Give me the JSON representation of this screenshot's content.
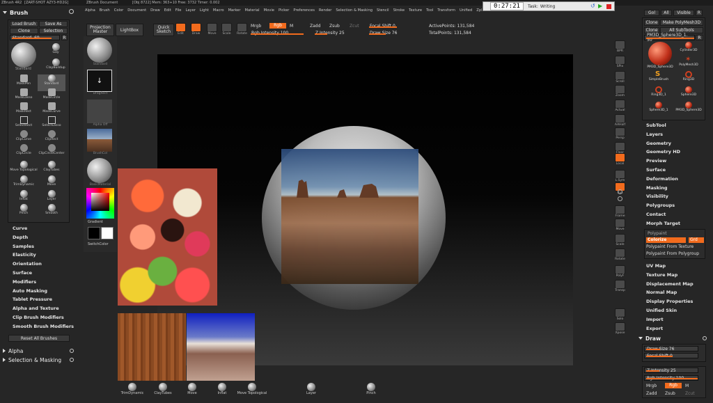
{
  "title_bar": {
    "app_label": "ZBrush 4R2",
    "info_text": "[ZART-SHOT AZY3-HD2G]",
    "document": "ZBrush Document",
    "stats": "[Obj 8722] Mem: 363+10 Free: 3732 Timer: 0.002"
  },
  "menu": [
    "Alpha",
    "Brush",
    "Color",
    "Document",
    "Draw",
    "Edit",
    "File",
    "Layer",
    "Light",
    "Macro",
    "Marker",
    "Material",
    "Movie",
    "Picker",
    "Preferences",
    "Render",
    "Selection & Masking",
    "Stencil",
    "Stroke",
    "Texture",
    "Tool",
    "Transform",
    "Unified",
    "Zplugin",
    "Zscript"
  ],
  "timer": {
    "time": "0:27:21",
    "task_label": "Task:",
    "task_value": "Writing"
  },
  "right_header_buttons": [
    "Gol",
    "All",
    "Visible",
    "R"
  ],
  "brush_palette": {
    "title": "Brush",
    "load": "Load Brush",
    "save": "Save As",
    "clone": "Clone",
    "selection": "SelectIon",
    "slider_label": "Standard. 69",
    "slider_value_fraction": 0.8,
    "r_btn": "R",
    "brushes": [
      {
        "label": "Standard",
        "icon": "sphere-icon"
      },
      {
        "label": "Gay",
        "icon": "sphere-icon"
      },
      {
        "label": "ClayBuildup",
        "icon": "sphere-icon"
      },
      {
        "label": "MaskPen",
        "icon": "mask-icon"
      },
      {
        "label": "Standard",
        "icon": "sphere-icon"
      },
      {
        "label": "MaskLasso",
        "icon": "mask-icon"
      },
      {
        "label": "MaskCircle",
        "icon": "mask-icon"
      },
      {
        "label": "MaskRect",
        "icon": "mask-icon"
      },
      {
        "label": "MaskCurve",
        "icon": "mask-icon"
      },
      {
        "label": "SelectRect",
        "icon": "select-icon"
      },
      {
        "label": "SelectLasso",
        "icon": "select-icon"
      },
      {
        "label": "ClipCurve",
        "icon": "clip-icon"
      },
      {
        "label": "ClipRect",
        "icon": "clip-icon"
      },
      {
        "label": "ClipCircle",
        "icon": "clip-icon"
      },
      {
        "label": "ClipCircleCenter",
        "icon": "clip-icon"
      },
      {
        "label": "Move Topological",
        "icon": "sphere-icon"
      },
      {
        "label": "ClayTubes",
        "icon": "sphere-icon"
      },
      {
        "label": "TrimDynamic",
        "icon": "sphere-icon"
      },
      {
        "label": "Move",
        "icon": "sphere-icon"
      },
      {
        "label": "Inflat",
        "icon": "sphere-icon"
      },
      {
        "label": "Layer",
        "icon": "sphere-icon"
      },
      {
        "label": "Pinch",
        "icon": "sphere-icon"
      },
      {
        "label": "Smooth",
        "icon": "sphere-icon"
      }
    ],
    "sections": [
      "Curve",
      "Depth",
      "Samples",
      "Elasticity",
      "Orientation",
      "Surface",
      "Modifiers",
      "Auto Masking",
      "Tablet Pressure",
      "Alpha and Texture",
      "Clip Brush Modifiers",
      "Smooth Brush Modifiers"
    ],
    "reset": "Reset All Brushes"
  },
  "left_bottom": {
    "alpha": "Alpha",
    "selection_masking": "Selection & Masking"
  },
  "tray": {
    "items": [
      {
        "label": "Standard"
      },
      {
        "label": "DragRect"
      },
      {
        "label": "Alpha Off"
      },
      {
        "label": "BrushCol"
      },
      {
        "label": "BasicMaterial"
      },
      {
        "label": "Gradient"
      },
      {
        "label": "SwitchColor"
      }
    ]
  },
  "top_toolbar": {
    "projection_master": "Projection Master",
    "lightbox": "LightBox",
    "quick_sketch": "Quick Sketch",
    "tools": [
      {
        "label": "Edit",
        "icon": "edit-icon",
        "active": true
      },
      {
        "label": "Draw",
        "icon": "draw-icon",
        "active": true
      },
      {
        "label": "Move",
        "icon": "move-icon",
        "active": false
      },
      {
        "label": "Scale",
        "icon": "scale-icon",
        "active": false
      },
      {
        "label": "Rotate",
        "icon": "rotate-icon",
        "active": false
      }
    ],
    "mrgb": "Mrgb",
    "rgb": "Rgb",
    "m": "M",
    "rgb_intensity": "Rgb Intensity 100",
    "rgb_intensity_fraction": 1.0,
    "zadd": "Zadd",
    "zsub": "Zsub",
    "zcut": "Zcut",
    "z_intensity": "Z Intensity 25",
    "z_intensity_fraction": 0.25,
    "focal_shift": "Focal Shift 0",
    "focal_shift_fraction": 0.5,
    "draw_size": "Draw Size 76",
    "draw_size_fraction": 0.3,
    "active_points": "ActivePoints: 131,584",
    "total_points": "TotalPoints: 131,584"
  },
  "right_shelf": [
    {
      "label": "BPR",
      "icon": "bpr-icon"
    },
    {
      "label": "SPix",
      "icon": "spix-icon"
    },
    {
      "label": "Scroll",
      "icon": "scroll-icon"
    },
    {
      "label": "Zoom",
      "icon": "zoom-icon"
    },
    {
      "label": "Actual",
      "icon": "actual-icon"
    },
    {
      "label": "AAHalf",
      "icon": "aahalf-icon"
    },
    {
      "label": "Persp",
      "icon": "persp-icon"
    },
    {
      "label": "Floor",
      "icon": "floor-icon"
    },
    {
      "label": "Local",
      "icon": "local-icon"
    },
    {
      "label": "L.Sym",
      "icon": "lsym-icon"
    },
    {
      "label": "Xyz",
      "icon": "xyz-icon"
    },
    {
      "label": "",
      "icon": "axis-icon"
    },
    {
      "label": "",
      "icon": "axis-icon"
    },
    {
      "label": "Frame",
      "icon": "frame-icon"
    },
    {
      "label": "Move",
      "icon": "move-icon"
    },
    {
      "label": "Scale",
      "icon": "scale-icon"
    },
    {
      "label": "Rotate",
      "icon": "rotate-icon"
    },
    {
      "label": "PolyF",
      "icon": "polyf-icon"
    },
    {
      "label": "Transp",
      "icon": "transp-icon"
    },
    {
      "label": "Solo",
      "icon": "solo-icon"
    },
    {
      "label": "Xpose",
      "icon": "xpose-icon"
    }
  ],
  "tool_palette": {
    "buttons_row1": [
      "Clone",
      "Make PolyMesh3D"
    ],
    "buttons_row2": [
      "Clone",
      "All SubTools"
    ],
    "slider_label": "PM3D_Sphere3D_1. 50",
    "r_btn": "R",
    "thumbs": [
      {
        "label": "PM3D_Sphere3D",
        "icon": "red-sphere-icon"
      },
      {
        "label": "Cylinder3D",
        "icon": "red-sphere-icon"
      },
      {
        "label": "PolyMesh3D",
        "icon": "star-icon"
      },
      {
        "label": "SimpleBrush",
        "icon": "s-icon"
      },
      {
        "label": "Ring3D",
        "icon": "ring-icon"
      },
      {
        "label": "Ring3D_1",
        "icon": "ring-icon"
      },
      {
        "label": "Sphere3D",
        "icon": "red-sphere-icon"
      },
      {
        "label": "Sphere3D_1",
        "icon": "red-sphere-icon"
      },
      {
        "label": "PM3D_Sphere3D",
        "icon": "red-sphere-icon"
      }
    ],
    "sections": [
      "SubTool",
      "Layers",
      "Geometry",
      "Geometry HD",
      "Preview",
      "Surface",
      "Deformation",
      "Masking",
      "Visibility",
      "Polygroups",
      "Contact",
      "Morph Target"
    ],
    "polypaint": "Polypaint",
    "colorize": "Colorize",
    "grd": "Grd",
    "from_texture": "Polypaint From Texture",
    "from_polygroup": "Polypaint From Polygroup",
    "sections2": [
      "UV Map",
      "Texture Map",
      "Displacement Map",
      "Normal Map",
      "Display Properties",
      "Unified Skin",
      "Import",
      "Export"
    ]
  },
  "draw_palette": {
    "title": "Draw",
    "draw_size": "Draw Size 76",
    "focal_shift": "Focal Shift 0",
    "z_intensity": "Z Intensity 25",
    "rgb_intensity": "Rgb Intensity 100",
    "mrgb": "Mrgb",
    "rgb": "Rgb",
    "m": "M",
    "zadd": "Zadd",
    "zsub": "Zsub",
    "zcut": "Zcut"
  },
  "bottom_shelf": [
    {
      "label": "TrimDynamic"
    },
    {
      "label": "ClayTubes"
    },
    {
      "label": "Move"
    },
    {
      "label": "Inflat"
    },
    {
      "label": "Move Topological"
    },
    {
      "label": "Layer"
    },
    {
      "label": "Pinch"
    }
  ],
  "colors": {
    "accent": "#f26b1d",
    "background": "#262626",
    "panel": "#2c2c2c"
  }
}
